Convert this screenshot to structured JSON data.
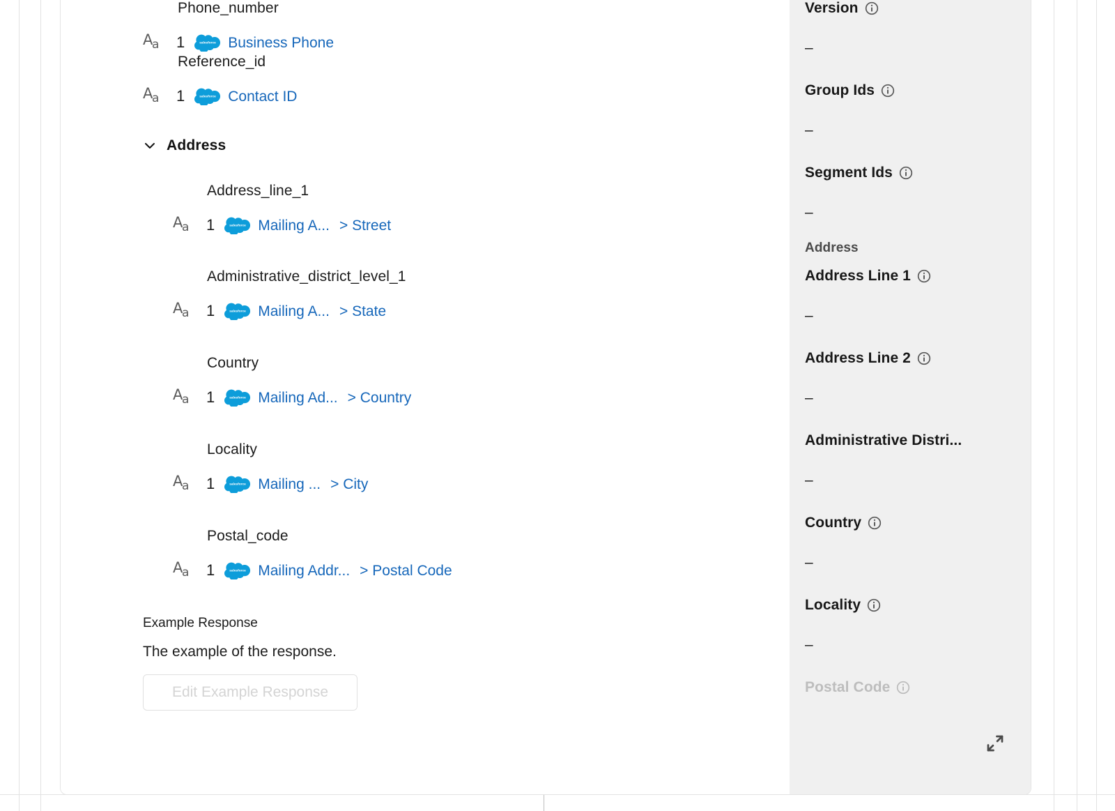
{
  "mappings": {
    "groups": [
      {
        "type": "field",
        "level": 0,
        "label": "Phone_number",
        "count": "1",
        "source_icon": "salesforce-icon",
        "source": "Business Phone",
        "sub": ""
      },
      {
        "type": "field",
        "level": 0,
        "label": "Reference_id",
        "count": "1",
        "source_icon": "salesforce-icon",
        "source": "Contact ID",
        "sub": ""
      },
      {
        "type": "section",
        "label": "Address",
        "expanded": true,
        "children": [
          {
            "type": "field",
            "level": 1,
            "label": "Address_line_1",
            "count": "1",
            "source_icon": "salesforce-icon",
            "source": "Mailing A...",
            "sub": "> Street"
          },
          {
            "type": "field",
            "level": 1,
            "label": "Administrative_district_level_1",
            "count": "1",
            "source_icon": "salesforce-icon",
            "source": "Mailing A...",
            "sub": "> State"
          },
          {
            "type": "field",
            "level": 1,
            "label": "Country",
            "count": "1",
            "source_icon": "salesforce-icon",
            "source": "Mailing Ad...",
            "sub": "> Country"
          },
          {
            "type": "field",
            "level": 1,
            "label": "Locality",
            "count": "1",
            "source_icon": "salesforce-icon",
            "source": "Mailing ...",
            "sub": "> City"
          },
          {
            "type": "field",
            "level": 1,
            "label": "Postal_code",
            "count": "1",
            "source_icon": "salesforce-icon",
            "source": "Mailing Addr...",
            "sub": "> Postal Code"
          }
        ]
      }
    ]
  },
  "example_response": {
    "title": "Example Response",
    "description": "The example of the response.",
    "button_label": "Edit Example Response",
    "button_disabled": true
  },
  "side_panel": {
    "items": [
      {
        "kind": "field",
        "label": "Version",
        "has_info": true,
        "value": "–",
        "faded": false
      },
      {
        "kind": "field",
        "label": "Group Ids",
        "has_info": true,
        "value": "–",
        "faded": false
      },
      {
        "kind": "field",
        "label": "Segment Ids",
        "has_info": true,
        "value": "–",
        "faded": false
      },
      {
        "kind": "group",
        "label": "Address",
        "has_info": false,
        "value": "",
        "faded": false
      },
      {
        "kind": "field",
        "label": "Address Line 1",
        "has_info": true,
        "value": "–",
        "faded": false
      },
      {
        "kind": "field",
        "label": "Address Line 2",
        "has_info": true,
        "value": "–",
        "faded": false
      },
      {
        "kind": "field",
        "label": "Administrative Distri...",
        "has_info": false,
        "value": "–",
        "faded": false
      },
      {
        "kind": "field",
        "label": "Country",
        "has_info": true,
        "value": "–",
        "faded": false
      },
      {
        "kind": "field",
        "label": "Locality",
        "has_info": true,
        "value": "–",
        "faded": false
      },
      {
        "kind": "field",
        "label": "Postal Code",
        "has_info": true,
        "value": "",
        "faded": true
      }
    ],
    "expand_icon": "expand-diagonal-icon"
  },
  "colors": {
    "link": "#1667ba",
    "salesforce_blue": "#00a1e0",
    "panel_bg": "#f0f0f0",
    "text": "#1b1b1b",
    "muted": "#bdbdbd"
  }
}
